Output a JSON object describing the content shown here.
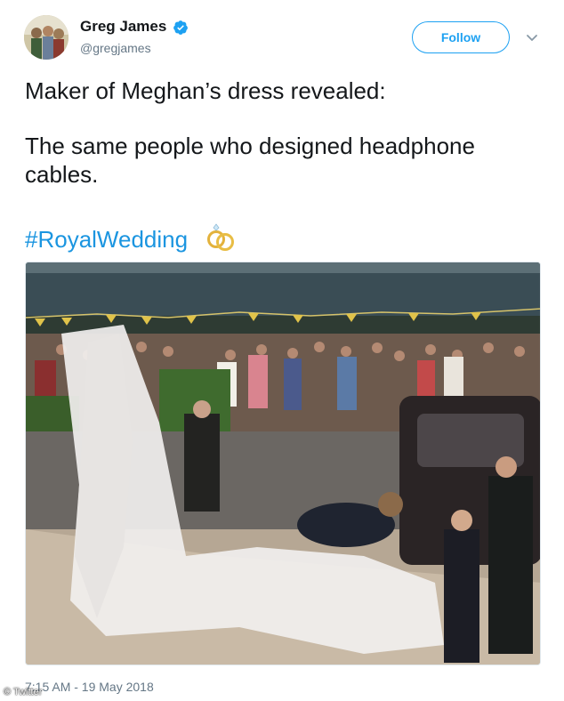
{
  "author": {
    "name": "Greg James",
    "handle": "@gregjames",
    "avatar": "avatar-photo",
    "verified_icon": "verified-badge-icon"
  },
  "actions": {
    "follow_label": "Follow",
    "caret_icon": "chevron-down-icon"
  },
  "tweet": {
    "lines": [
      "Maker of Meghan’s dress revealed:",
      "The same people who designed headphone",
      "cables."
    ],
    "hashtag": "#RoyalWedding",
    "emoji_icon": "wedding-rings-icon"
  },
  "media": {
    "photo": "royal-wedding-photo"
  },
  "footer": {
    "timestamp": "7:15 AM - 19 May 2018",
    "watermark": "© Twitter"
  },
  "colors": {
    "accent": "#1da1f2",
    "link": "#1b95e0",
    "muted": "#657786",
    "text": "#14171a"
  }
}
